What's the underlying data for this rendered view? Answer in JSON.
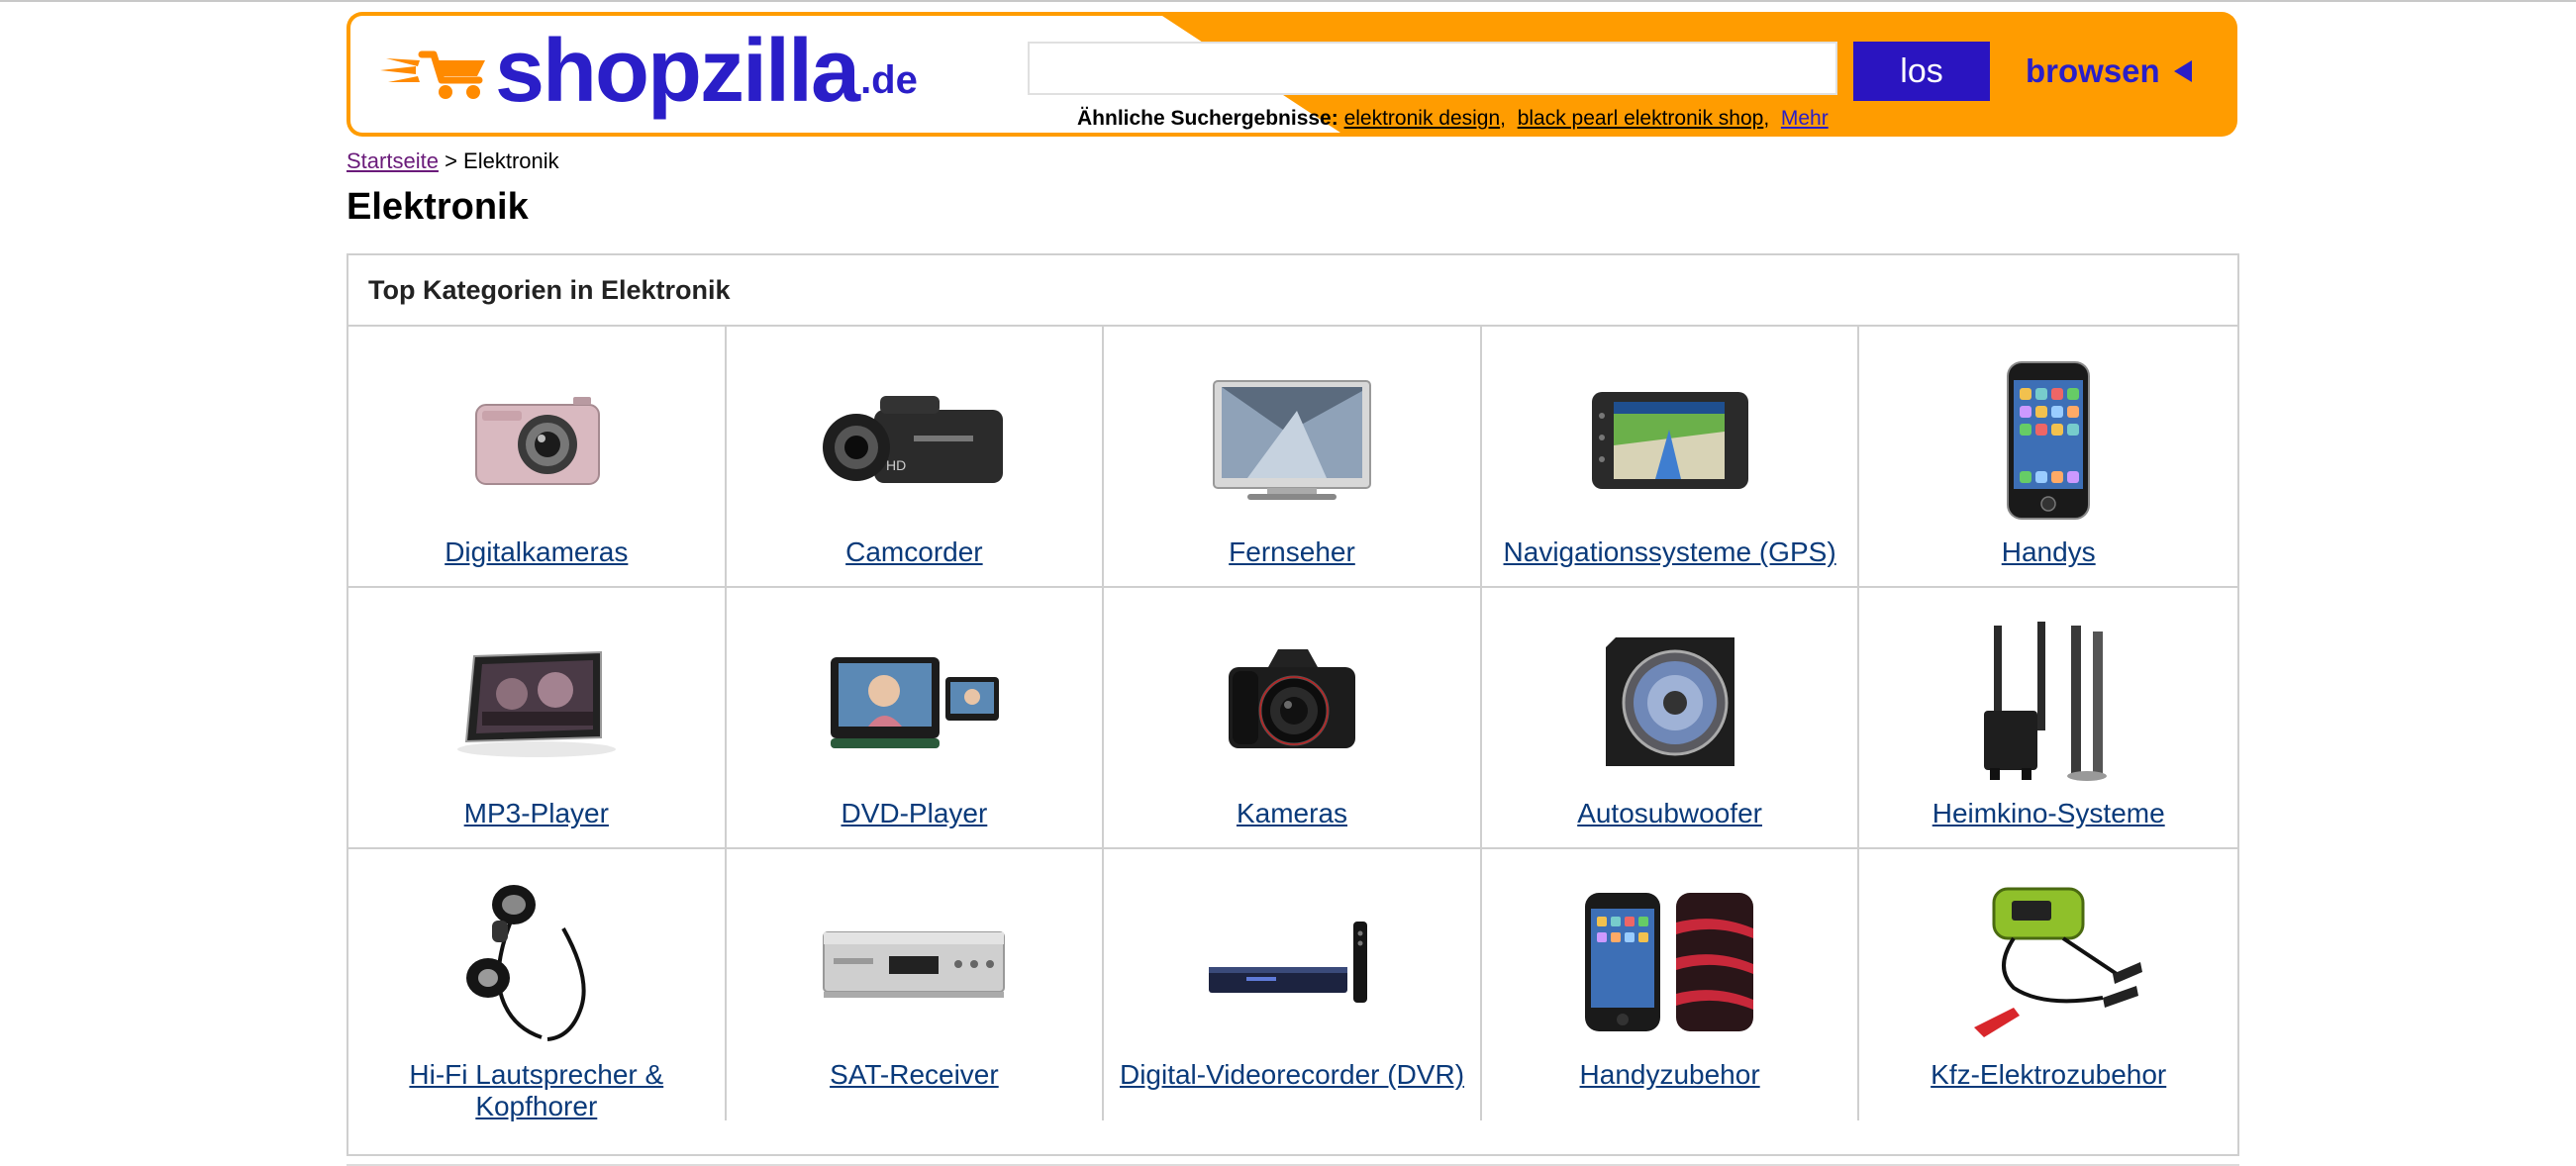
{
  "header": {
    "logo_word": "shopzilla",
    "logo_tld": ".de",
    "search_placeholder": "",
    "search_button": "los",
    "browse_label": "browsen",
    "related_label": "Ähnliche Suchergebnisse:",
    "related_links": [
      "elektronik design",
      "black pearl elektronik shop"
    ],
    "related_more": "Mehr",
    "colors": {
      "bar": "#ff9c00",
      "brand": "#2a1ec8",
      "button": "#2a14c0"
    }
  },
  "breadcrumb": {
    "home": "Startseite",
    "separator": ">",
    "current": "Elektronik"
  },
  "page_title": "Elektronik",
  "categories": {
    "heading": "Top Kategorien in Elektronik",
    "items": [
      {
        "label": "Digitalkameras",
        "icon": "compact-camera-icon"
      },
      {
        "label": "Camcorder",
        "icon": "camcorder-icon"
      },
      {
        "label": "Fernseher",
        "icon": "television-icon"
      },
      {
        "label": "Navigationssysteme (GPS)",
        "icon": "gps-navigator-icon"
      },
      {
        "label": "Handys",
        "icon": "smartphone-icon"
      },
      {
        "label": "MP3-Player",
        "icon": "mp3-player-icon"
      },
      {
        "label": "DVD-Player",
        "icon": "portable-dvd-player-icon"
      },
      {
        "label": "Kameras",
        "icon": "dslr-camera-icon"
      },
      {
        "label": "Autosubwoofer",
        "icon": "car-subwoofer-icon"
      },
      {
        "label": "Heimkino-Systeme",
        "icon": "home-theater-speakers-icon"
      },
      {
        "label": "Hi-Fi Lautsprecher & Kopfhorer",
        "icon": "earphones-icon"
      },
      {
        "label": "SAT-Receiver",
        "icon": "satellite-receiver-icon"
      },
      {
        "label": "Digital-Videorecorder (DVR)",
        "icon": "dvr-recorder-icon"
      },
      {
        "label": "Handyzubehor",
        "icon": "phone-cases-icon"
      },
      {
        "label": "Kfz-Elektrozubehor",
        "icon": "battery-charger-icon"
      }
    ]
  }
}
